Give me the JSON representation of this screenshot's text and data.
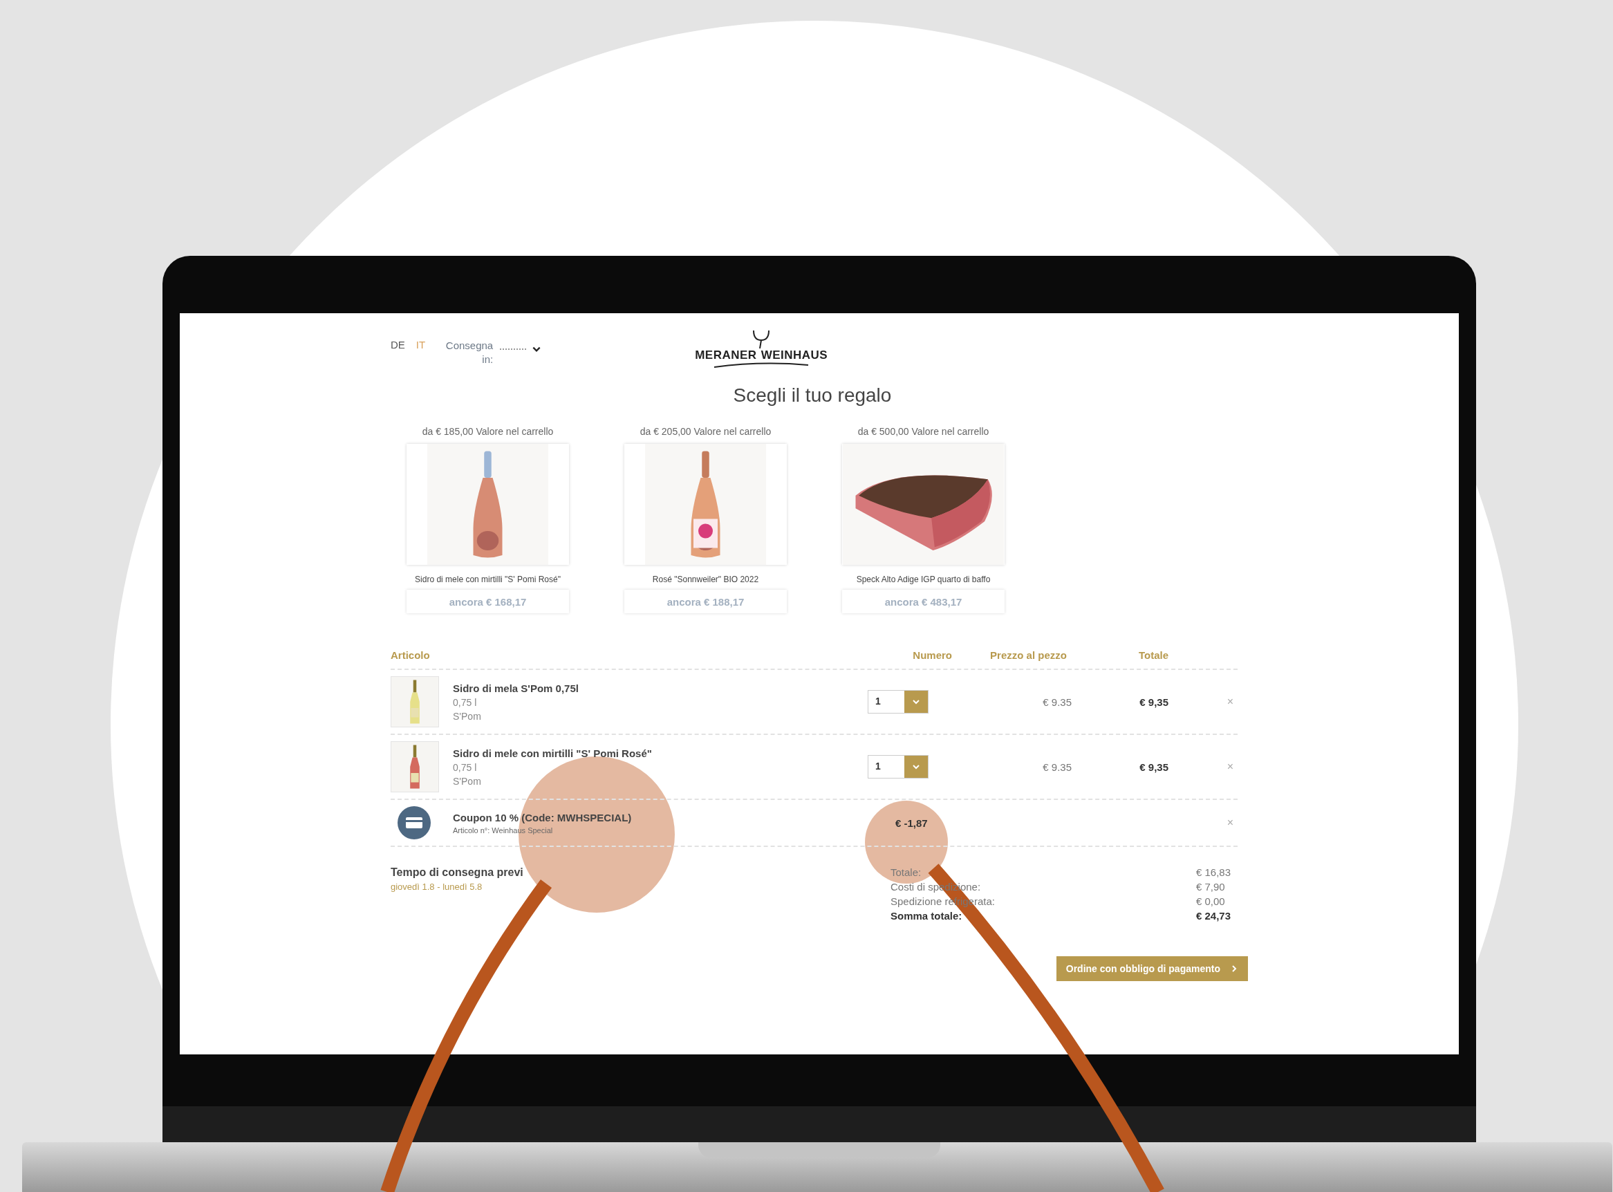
{
  "header": {
    "languages": [
      {
        "label": "DE",
        "selected": false
      },
      {
        "label": "IT",
        "selected": true
      }
    ],
    "delivery_label": "Consegna in:"
  },
  "logo": {
    "left": "MERANER",
    "right": "WEINHAUS"
  },
  "gift_section": {
    "title": "Scegli il tuo regalo",
    "gifts": [
      {
        "threshold": "da € 185,00 Valore nel carrello",
        "name": "Sidro di mele con mirtilli \"S' Pomi Rosé\"",
        "remaining": "ancora € 168,17"
      },
      {
        "threshold": "da € 205,00 Valore nel carrello",
        "name": "Rosé \"Sonnweiler\" BIO 2022",
        "remaining": "ancora € 188,17"
      },
      {
        "threshold": "da € 500,00 Valore nel carrello",
        "name": "Speck Alto Adige IGP quarto di baffo",
        "remaining": "ancora € 483,17"
      }
    ]
  },
  "cart": {
    "columns": [
      "Articolo",
      "Numero",
      "Prezzo al pezzo",
      "Totale"
    ],
    "rows": [
      {
        "kind": "product",
        "name": "Sidro di mela S'Pom 0,75l",
        "size": "0,75 l",
        "producer": "S'Pom",
        "quantity": "1",
        "unit_price": "€ 9.35",
        "total": "€ 9,35",
        "remove": "×"
      },
      {
        "kind": "product",
        "name": "Sidro di mele con mirtilli \"S' Pomi Rosé\"",
        "size": "0,75 l",
        "producer": "S'Pom",
        "quantity": "1",
        "unit_price": "€ 9.35",
        "total": "€ 9,35",
        "remove": "×"
      },
      {
        "kind": "coupon",
        "name": "Coupon 10 % (Code: MWHSPECIAL)",
        "article": "Articolo n°: Weinhaus Special",
        "amount": "€ -1,87",
        "remove": "×"
      }
    ]
  },
  "delivery": {
    "title": "Tempo di consegna previ",
    "dates": "giovedì 1.8 - lunedì 5.8"
  },
  "totals": [
    {
      "label": "Totale:",
      "value": "€ 16,83",
      "bold": false
    },
    {
      "label": "Costi di spedizione:",
      "value": "€ 7,90",
      "bold": false
    },
    {
      "label": "Spedizione refrigerata:",
      "value": "€ 0,00",
      "bold": false
    },
    {
      "label": "Somma totale:",
      "value": "€ 24,73",
      "bold": true
    }
  ],
  "checkout_button": "Ordine con obbligo di pagamento"
}
